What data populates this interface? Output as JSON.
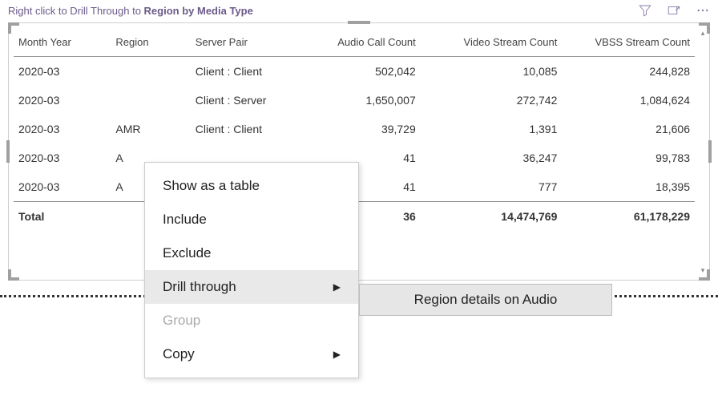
{
  "header": {
    "title_prefix": "Right click to Drill Through to ",
    "title_bold": "Region by Media Type"
  },
  "columns": {
    "month_year": "Month Year",
    "region": "Region",
    "server_pair": "Server Pair",
    "audio": "Audio Call Count",
    "video": "Video Stream Count",
    "vbss": "VBSS Stream Count"
  },
  "rows": [
    {
      "month_year": "2020-03",
      "region": "",
      "server_pair": "Client : Client",
      "audio": "502,042",
      "video": "10,085",
      "vbss": "244,828"
    },
    {
      "month_year": "2020-03",
      "region": "",
      "server_pair": "Client : Server",
      "audio": "1,650,007",
      "video": "272,742",
      "vbss": "1,084,624"
    },
    {
      "month_year": "2020-03",
      "region": "AMR",
      "server_pair": "Client : Client",
      "audio": "39,729",
      "video": "1,391",
      "vbss": "21,606"
    },
    {
      "month_year": "2020-03",
      "region": "A",
      "server_pair": "",
      "audio": "41",
      "video": "36,247",
      "vbss": "99,783"
    },
    {
      "month_year": "2020-03",
      "region": "A",
      "server_pair": "",
      "audio": "41",
      "video": "777",
      "vbss": "18,395"
    }
  ],
  "total_row": {
    "label": "Total",
    "audio": "36",
    "video": "14,474,769",
    "vbss": "61,178,229"
  },
  "context_menu": {
    "items": {
      "show_table": "Show as a table",
      "include": "Include",
      "exclude": "Exclude",
      "drill_through": "Drill through",
      "group": "Group",
      "copy": "Copy"
    }
  },
  "submenu": {
    "region_details_audio": "Region details on Audio"
  }
}
